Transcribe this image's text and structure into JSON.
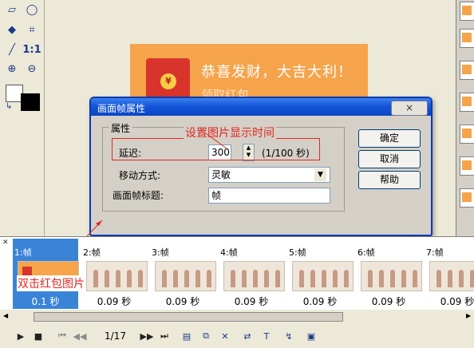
{
  "toolbox": {
    "tools": [
      "eraser-icon",
      "lasso-icon",
      "fill-bucket-icon",
      "crop-icon",
      "eyedropper-icon",
      "actual-size-icon",
      "zoom-in-icon",
      "zoom-out-icon"
    ],
    "actual_size_label": "1:1"
  },
  "banner": {
    "title": "恭喜发财，大吉大利！",
    "subtitle": "领取红包"
  },
  "dialog": {
    "title": "画面帧属性",
    "close_label": "×",
    "group_label": "属性",
    "delay_label": "延迟:",
    "delay_value": "300",
    "delay_unit": "(1/100 秒)",
    "move_label": "移动方式:",
    "move_value": "灵敏",
    "frame_title_label": "画面帧标题:",
    "frame_title_value": "帧",
    "ok": "确定",
    "cancel": "取消",
    "help": "帮助"
  },
  "annotations": {
    "set_display_time": "设置图片显示时间",
    "double_click": "双击红包图片"
  },
  "frames": [
    {
      "label": "1:帧",
      "delay": "0.1 秒"
    },
    {
      "label": "2:帧",
      "delay": "0.09 秒"
    },
    {
      "label": "3:帧",
      "delay": "0.09 秒"
    },
    {
      "label": "4:帧",
      "delay": "0.09 秒"
    },
    {
      "label": "5:帧",
      "delay": "0.09 秒"
    },
    {
      "label": "6:帧",
      "delay": "0.09 秒"
    },
    {
      "label": "7:帧",
      "delay": "0.09 秒"
    }
  ],
  "player": {
    "frame_counter": "1/17"
  },
  "colors": {
    "accent": "#0a46c4",
    "annotation": "#e0271f",
    "banner": "#f5a44c",
    "selection": "#3a84d8"
  }
}
